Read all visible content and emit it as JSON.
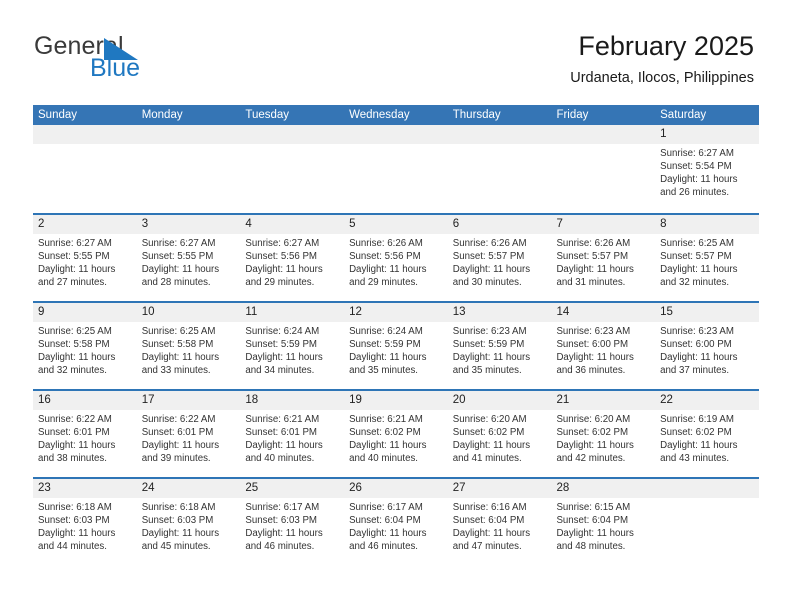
{
  "brand": {
    "name_part1": "General",
    "name_part2": "Blue",
    "flag_color": "#1f78c1",
    "text_color": "#3a3a3a"
  },
  "header": {
    "title": "February 2025",
    "subtitle": "Urdaneta, Ilocos, Philippines"
  },
  "theme": {
    "header_blue": "#3575b5",
    "row_separator_blue": "#2e75b6",
    "day_band_gray": "#f0f0f0"
  },
  "calendar": {
    "weekdays": [
      "Sunday",
      "Monday",
      "Tuesday",
      "Wednesday",
      "Thursday",
      "Friday",
      "Saturday"
    ],
    "labels": {
      "sunrise": "Sunrise:",
      "sunset": "Sunset:",
      "daylight": "Daylight:"
    },
    "weeks": [
      [
        {
          "day": "",
          "empty": true
        },
        {
          "day": "",
          "empty": true
        },
        {
          "day": "",
          "empty": true
        },
        {
          "day": "",
          "empty": true
        },
        {
          "day": "",
          "empty": true
        },
        {
          "day": "",
          "empty": true
        },
        {
          "day": "1",
          "sunrise": "Sunrise: 6:27 AM",
          "sunset": "Sunset: 5:54 PM",
          "daylight": "Daylight: 11 hours and 26 minutes."
        }
      ],
      [
        {
          "day": "2",
          "sunrise": "Sunrise: 6:27 AM",
          "sunset": "Sunset: 5:55 PM",
          "daylight": "Daylight: 11 hours and 27 minutes."
        },
        {
          "day": "3",
          "sunrise": "Sunrise: 6:27 AM",
          "sunset": "Sunset: 5:55 PM",
          "daylight": "Daylight: 11 hours and 28 minutes."
        },
        {
          "day": "4",
          "sunrise": "Sunrise: 6:27 AM",
          "sunset": "Sunset: 5:56 PM",
          "daylight": "Daylight: 11 hours and 29 minutes."
        },
        {
          "day": "5",
          "sunrise": "Sunrise: 6:26 AM",
          "sunset": "Sunset: 5:56 PM",
          "daylight": "Daylight: 11 hours and 29 minutes."
        },
        {
          "day": "6",
          "sunrise": "Sunrise: 6:26 AM",
          "sunset": "Sunset: 5:57 PM",
          "daylight": "Daylight: 11 hours and 30 minutes."
        },
        {
          "day": "7",
          "sunrise": "Sunrise: 6:26 AM",
          "sunset": "Sunset: 5:57 PM",
          "daylight": "Daylight: 11 hours and 31 minutes."
        },
        {
          "day": "8",
          "sunrise": "Sunrise: 6:25 AM",
          "sunset": "Sunset: 5:57 PM",
          "daylight": "Daylight: 11 hours and 32 minutes."
        }
      ],
      [
        {
          "day": "9",
          "sunrise": "Sunrise: 6:25 AM",
          "sunset": "Sunset: 5:58 PM",
          "daylight": "Daylight: 11 hours and 32 minutes."
        },
        {
          "day": "10",
          "sunrise": "Sunrise: 6:25 AM",
          "sunset": "Sunset: 5:58 PM",
          "daylight": "Daylight: 11 hours and 33 minutes."
        },
        {
          "day": "11",
          "sunrise": "Sunrise: 6:24 AM",
          "sunset": "Sunset: 5:59 PM",
          "daylight": "Daylight: 11 hours and 34 minutes."
        },
        {
          "day": "12",
          "sunrise": "Sunrise: 6:24 AM",
          "sunset": "Sunset: 5:59 PM",
          "daylight": "Daylight: 11 hours and 35 minutes."
        },
        {
          "day": "13",
          "sunrise": "Sunrise: 6:23 AM",
          "sunset": "Sunset: 5:59 PM",
          "daylight": "Daylight: 11 hours and 35 minutes."
        },
        {
          "day": "14",
          "sunrise": "Sunrise: 6:23 AM",
          "sunset": "Sunset: 6:00 PM",
          "daylight": "Daylight: 11 hours and 36 minutes."
        },
        {
          "day": "15",
          "sunrise": "Sunrise: 6:23 AM",
          "sunset": "Sunset: 6:00 PM",
          "daylight": "Daylight: 11 hours and 37 minutes."
        }
      ],
      [
        {
          "day": "16",
          "sunrise": "Sunrise: 6:22 AM",
          "sunset": "Sunset: 6:01 PM",
          "daylight": "Daylight: 11 hours and 38 minutes."
        },
        {
          "day": "17",
          "sunrise": "Sunrise: 6:22 AM",
          "sunset": "Sunset: 6:01 PM",
          "daylight": "Daylight: 11 hours and 39 minutes."
        },
        {
          "day": "18",
          "sunrise": "Sunrise: 6:21 AM",
          "sunset": "Sunset: 6:01 PM",
          "daylight": "Daylight: 11 hours and 40 minutes."
        },
        {
          "day": "19",
          "sunrise": "Sunrise: 6:21 AM",
          "sunset": "Sunset: 6:02 PM",
          "daylight": "Daylight: 11 hours and 40 minutes."
        },
        {
          "day": "20",
          "sunrise": "Sunrise: 6:20 AM",
          "sunset": "Sunset: 6:02 PM",
          "daylight": "Daylight: 11 hours and 41 minutes."
        },
        {
          "day": "21",
          "sunrise": "Sunrise: 6:20 AM",
          "sunset": "Sunset: 6:02 PM",
          "daylight": "Daylight: 11 hours and 42 minutes."
        },
        {
          "day": "22",
          "sunrise": "Sunrise: 6:19 AM",
          "sunset": "Sunset: 6:02 PM",
          "daylight": "Daylight: 11 hours and 43 minutes."
        }
      ],
      [
        {
          "day": "23",
          "sunrise": "Sunrise: 6:18 AM",
          "sunset": "Sunset: 6:03 PM",
          "daylight": "Daylight: 11 hours and 44 minutes."
        },
        {
          "day": "24",
          "sunrise": "Sunrise: 6:18 AM",
          "sunset": "Sunset: 6:03 PM",
          "daylight": "Daylight: 11 hours and 45 minutes."
        },
        {
          "day": "25",
          "sunrise": "Sunrise: 6:17 AM",
          "sunset": "Sunset: 6:03 PM",
          "daylight": "Daylight: 11 hours and 46 minutes."
        },
        {
          "day": "26",
          "sunrise": "Sunrise: 6:17 AM",
          "sunset": "Sunset: 6:04 PM",
          "daylight": "Daylight: 11 hours and 46 minutes."
        },
        {
          "day": "27",
          "sunrise": "Sunrise: 6:16 AM",
          "sunset": "Sunset: 6:04 PM",
          "daylight": "Daylight: 11 hours and 47 minutes."
        },
        {
          "day": "28",
          "sunrise": "Sunrise: 6:15 AM",
          "sunset": "Sunset: 6:04 PM",
          "daylight": "Daylight: 11 hours and 48 minutes."
        },
        {
          "day": "",
          "empty": true
        }
      ]
    ]
  }
}
